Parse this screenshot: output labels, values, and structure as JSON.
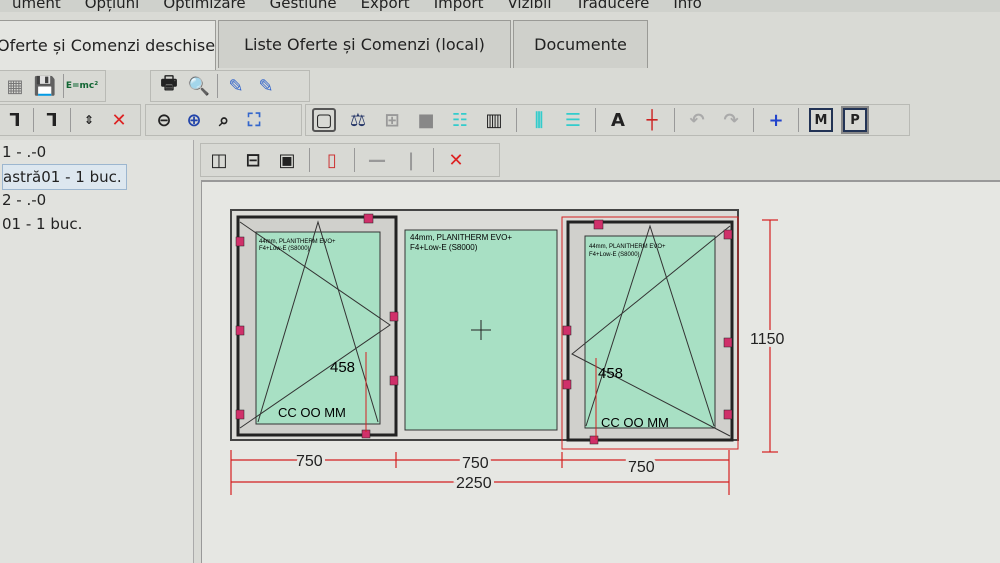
{
  "menu": [
    "ument",
    "Opțiuni",
    "Optimizare",
    "Gestiune",
    "Export",
    "Import",
    "Vizibil",
    "Traducere",
    "Info"
  ],
  "tabs": [
    {
      "label": "Oferte și Comenzi deschise",
      "active": true
    },
    {
      "label": "Liste Oferte și Comenzi   (local)"
    },
    {
      "label": "Documente"
    }
  ],
  "toolbar": {
    "emc_label": "E=mc²",
    "text_tool": "A",
    "m_button": "M",
    "p_button": "P"
  },
  "list": [
    "1 - .-0",
    "astră01 - 1 buc.",
    "2 - .-0",
    "01 - 1 buc."
  ],
  "drawing": {
    "glass_left": "44mm, PLANITHERM EVO+ F4+Low-E (S8000)",
    "glass_center_line1": "44mm, PLANITHERM EVO+",
    "glass_center_line2": "F4+Low-E (S8000)",
    "glass_small_line1": "44mm, PLANITHERM EVO+",
    "glass_small_line2": "F4+Low-E (S8000)",
    "handle_height": "458",
    "hardware_label": "CC OO MM",
    "width_left": "750",
    "width_center": "750",
    "width_right": "750",
    "total_width": "2250",
    "height": "1150",
    "glass_color": "#a8e0c4",
    "handle_color": "#d0306a",
    "dim_color": "#d42020"
  }
}
